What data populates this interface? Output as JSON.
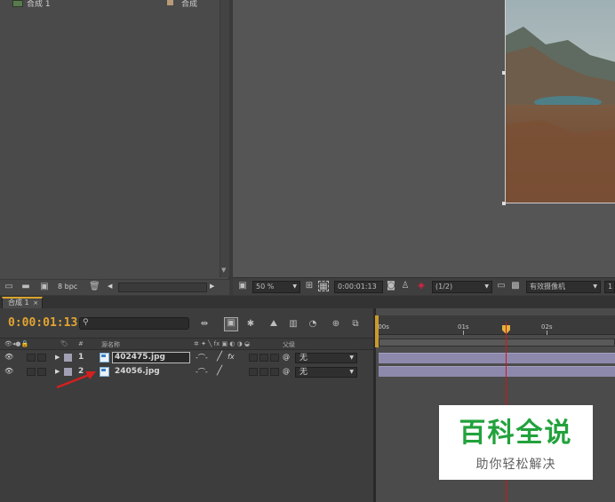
{
  "project": {
    "items": [
      {
        "name": "合成 1",
        "type": "合成"
      }
    ],
    "footer": {
      "bpc": "8 bpc"
    }
  },
  "viewer": {
    "zoom": "50 %",
    "timecode": "0:00:01:13",
    "resolution": "(1/2)",
    "camera": "有效摄像机"
  },
  "timeline": {
    "tab_label": "合成 1",
    "timecode": "0:00:01:13",
    "columns": {
      "number": "#",
      "source_name": "源名称",
      "parent": "父级"
    },
    "layers": [
      {
        "index": "1",
        "name": "402475.jpg",
        "parent": "无"
      },
      {
        "index": "2",
        "name": "24056.jpg",
        "parent": "无"
      }
    ],
    "ruler": {
      "ticks": [
        ":00s",
        "01s",
        "02s"
      ]
    },
    "playhead_time": "0:00:01:13"
  },
  "watermark": {
    "title": "百科全说",
    "subtitle": "助你轻松解决"
  },
  "colors": {
    "accent_timecode": "#e3a532",
    "playhead": "#d5141b",
    "layer_bar": "#8d89ad",
    "watermark_green": "#22a23c"
  }
}
